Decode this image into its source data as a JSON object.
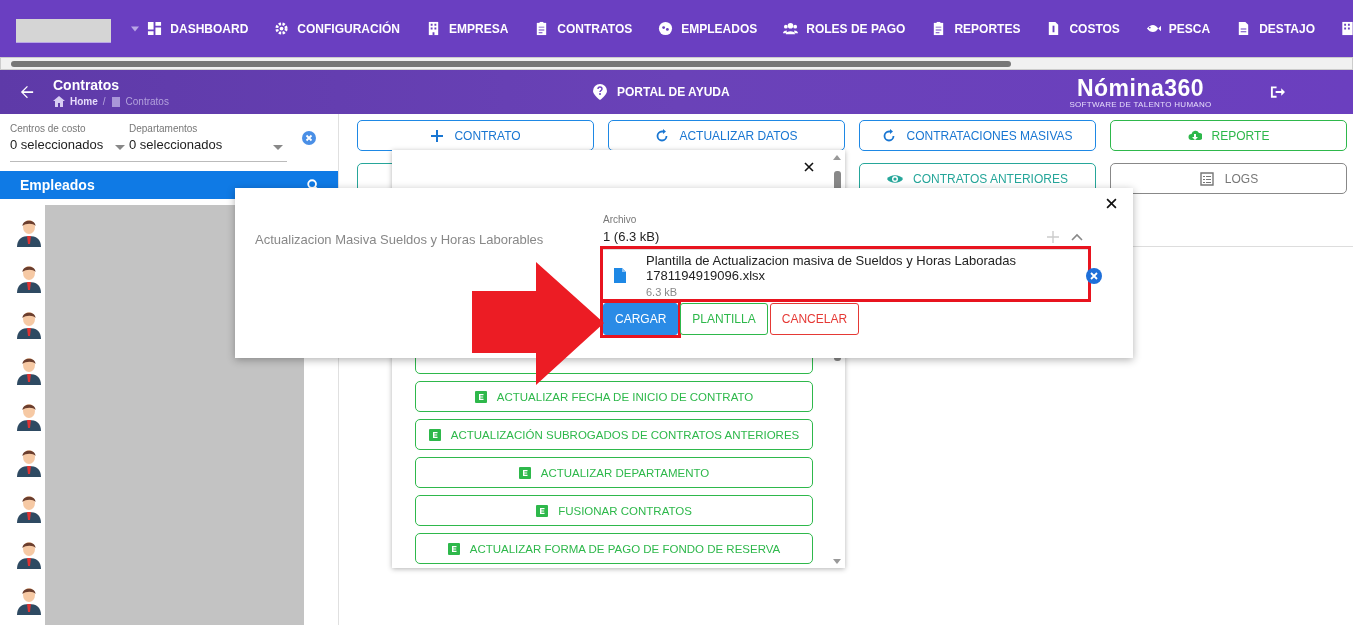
{
  "nav": {
    "items": [
      "DASHBOARD",
      "CONFIGURACIÓN",
      "EMPRESA",
      "CONTRATOS",
      "EMPLEADOS",
      "ROLES DE PAGO",
      "REPORTES",
      "COSTOS",
      "PESCA",
      "DESTAJO"
    ]
  },
  "header": {
    "title": "Contratos",
    "breadcrumb": [
      "Home",
      "Contratos"
    ],
    "breadcrumb_separator": "/",
    "help": "PORTAL DE AYUDA",
    "logo": "Nómina360",
    "tagline": "SOFTWARE DE TALENTO HUMANO"
  },
  "filters": [
    {
      "label": "Centros de costo",
      "value": "0 seleccionados"
    },
    {
      "label": "Departamentos",
      "value": "0 seleccionados"
    }
  ],
  "employees_panel": {
    "title": "Empleados"
  },
  "actions_row1": [
    {
      "label": "CONTRATO",
      "kind": "primary"
    },
    {
      "label": "ACTUALIZAR DATOS",
      "kind": "primary"
    },
    {
      "label": "CONTRATACIONES MASIVAS",
      "kind": "primary"
    },
    {
      "label": "REPORTE",
      "kind": "success"
    }
  ],
  "actions_row2": [
    {
      "kind": "teal"
    },
    {
      "label": "CONTRATOS ANTERIORES",
      "kind": "teal"
    },
    {
      "label": "LOGS",
      "kind": "neutral"
    }
  ],
  "dropdown": {
    "items": [
      "ACTUALIZAR FECHA DE INICIO DE CONTRATO",
      "ACTUALIZACIÓN SUBROGADOS DE CONTRATOS ANTERIORES",
      "ACTUALIZAR DEPARTAMENTO",
      "FUSIONAR CONTRATOS",
      "ACTUALIZAR FORMA DE PAGO DE FONDO DE RESERVA"
    ]
  },
  "modal": {
    "label": "Actualizacion Masiva Sueldos y Horas Laborables",
    "field_label": "Archivo",
    "summary": "1 (6.3 kB)",
    "file": {
      "name": "Plantilla de Actualizacion masiva de Sueldos y Horas Laboradas 1781194919096.xlsx",
      "size": "6.3 kB",
      "highlighted": true
    },
    "buttons": [
      {
        "label": "CARGAR",
        "kind": "primary",
        "highlighted": true
      },
      {
        "label": "PLANTILLA",
        "kind": "success",
        "highlighted": false
      },
      {
        "label": "CANCELAR",
        "kind": "danger",
        "highlighted": false
      }
    ]
  }
}
